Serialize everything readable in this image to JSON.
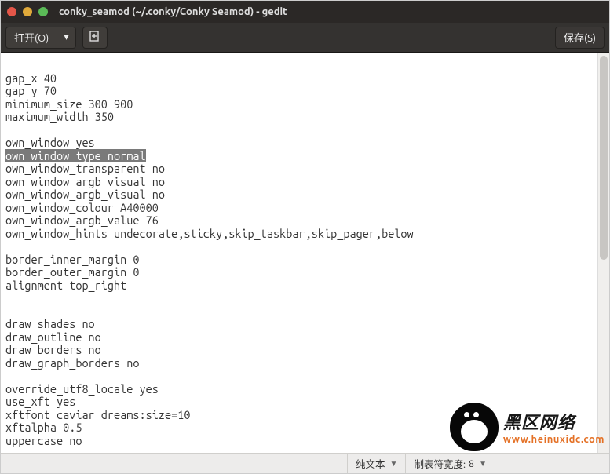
{
  "window": {
    "title": "conky_seamod (~/.conky/Conky Seamod) - gedit"
  },
  "toolbar": {
    "open_label": "打开(O)",
    "save_label": "保存(S)"
  },
  "editor": {
    "lines": [
      "",
      "gap_x 40",
      "gap_y 70",
      "minimum_size 300 900",
      "maximum_width 350",
      "",
      "own_window yes",
      "own_window_type normal",
      "own_window_transparent no",
      "own_window_argb_visual no",
      "own_window_argb_visual no",
      "own_window_colour A40000",
      "own_window_argb_value 76",
      "own_window_hints undecorate,sticky,skip_taskbar,skip_pager,below",
      "",
      "border_inner_margin 0",
      "border_outer_margin 0",
      "alignment top_right",
      "",
      "",
      "draw_shades no",
      "draw_outline no",
      "draw_borders no",
      "draw_graph_borders no",
      "",
      "override_utf8_locale yes",
      "use_xft yes",
      "xftfont caviar dreams:size=10",
      "xftalpha 0.5",
      "uppercase no"
    ],
    "selected_line_index": 7
  },
  "statusbar": {
    "syntax_label": "纯文本",
    "tabwidth_prefix": "制表符宽度:",
    "tabwidth_value": "8"
  },
  "watermark": {
    "line1": "黑区网络",
    "line2": "www.heinuxidc.com"
  }
}
